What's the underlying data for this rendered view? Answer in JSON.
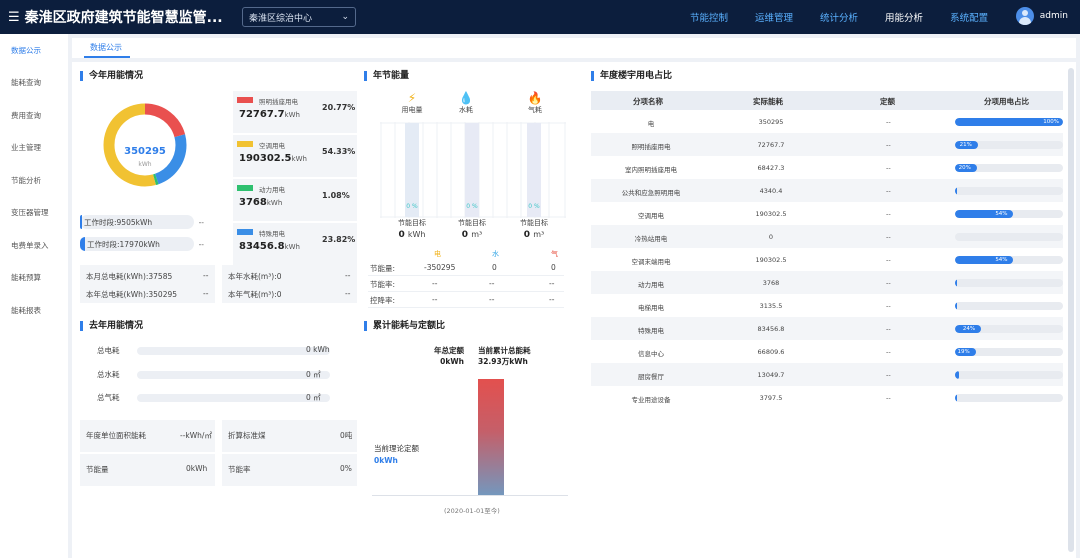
{
  "header": {
    "title": "秦淮区政府建筑节能智慧监管...",
    "org_select": "秦淮区综治中心",
    "nav": [
      "节能控制",
      "运维管理",
      "统计分析",
      "用能分析",
      "系统配置"
    ],
    "nav_active": 3,
    "user": "admin"
  },
  "sidebar": {
    "items": [
      "数据公示",
      "能耗查询",
      "费用查询",
      "业主管理",
      "节能分析",
      "变压器管理",
      "电费单录入",
      "能耗预算",
      "能耗报表"
    ]
  },
  "tab": {
    "label": "数据公示"
  },
  "this_year": {
    "title": "今年用能情况",
    "total": "350295",
    "total_unit": "kWh",
    "work_periods": [
      {
        "label": "工作时段:9505kWh",
        "dash": "--"
      },
      {
        "label": "工作时段:17970kWh",
        "dash": "--"
      }
    ],
    "categories": [
      {
        "name": "照明插座用电",
        "value": "72767.7",
        "unit": "kWh",
        "pct": "20.77%",
        "color": "#e9504f",
        "share": 20.77
      },
      {
        "name": "空调用电",
        "value": "190302.5",
        "unit": "kWh",
        "pct": "54.33%",
        "color": "#f1c232",
        "share": 54.33
      },
      {
        "name": "动力用电",
        "value": "3768",
        "unit": "kWh",
        "pct": "1.08%",
        "color": "#2ec06f",
        "share": 1.08
      },
      {
        "name": "特殊用电",
        "value": "83456.8",
        "unit": "kWh",
        "pct": "23.82%",
        "color": "#3a8ee6",
        "share": 23.82
      }
    ],
    "summary": {
      "month_elec": "本月总电耗(kWh):37585",
      "year_elec": "本年总电耗(kWh):350295",
      "year_water": "本年水耗(m³):0",
      "year_gas": "本年气耗(m³):0",
      "dash": "--"
    }
  },
  "saving": {
    "title": "年节能量",
    "columns": [
      {
        "label": "用电量",
        "icon": "lightning-icon",
        "glyph": "⚡",
        "color": "#f1b21b",
        "pct": "0 %",
        "target_label": "节能目标",
        "target": "0",
        "target_unit": "kWh"
      },
      {
        "label": "水耗",
        "icon": "water-drop-icon",
        "glyph": "💧",
        "color": "#37a7e6",
        "pct": "0 %",
        "target_label": "节能目标",
        "target": "0",
        "target_unit": "m³"
      },
      {
        "label": "气耗",
        "icon": "flame-icon",
        "glyph": "🔥",
        "color": "#e64c3c",
        "pct": "0 %",
        "target_label": "节能目标",
        "target": "0",
        "target_unit": "m³"
      }
    ],
    "table_headers": [
      "电",
      "水",
      "气"
    ],
    "rows": [
      {
        "label": "节能量:",
        "values": [
          "-350295",
          "0",
          "0"
        ]
      },
      {
        "label": "节能率:",
        "values": [
          "--",
          "--",
          "--"
        ]
      },
      {
        "label": "控降率:",
        "values": [
          "--",
          "--",
          "--"
        ]
      }
    ]
  },
  "last_year": {
    "title": "去年用能情况",
    "bars": [
      {
        "label": "总电耗",
        "value": "0 kWh"
      },
      {
        "label": "总水耗",
        "value": "0 ㎡"
      },
      {
        "label": "总气耗",
        "value": "0 ㎡"
      }
    ],
    "boxes": [
      {
        "label": "年度单位面积能耗",
        "value": "--kWh/㎡"
      },
      {
        "label": "折算标准煤",
        "value": "0吨"
      },
      {
        "label": "节能量",
        "value": "0kWh"
      },
      {
        "label": "节能率",
        "value": "0%"
      }
    ]
  },
  "cumulative": {
    "title": "累计能耗与定额比",
    "annual_quota_label": "年总定额",
    "annual_quota_value": "0kWh",
    "current_total_label": "当前累计总能耗",
    "current_total_value": "32.93万kWh",
    "theory_label": "当前理论定额",
    "theory_value": "0kWh",
    "date": "(2020-01-01至今)"
  },
  "building": {
    "title": "年度楼宇用电占比",
    "headers": [
      "分项名称",
      "实际能耗",
      "定额",
      "分项用电占比"
    ],
    "rows": [
      {
        "name": "电",
        "actual": "350295",
        "quota": "--",
        "pct": 100,
        "pct_label": "100%"
      },
      {
        "name": "照明插座用电",
        "actual": "72767.7",
        "quota": "--",
        "pct": 21,
        "pct_label": "21%"
      },
      {
        "name": "室内照明插座用电",
        "actual": "68427.3",
        "quota": "--",
        "pct": 20,
        "pct_label": "20%"
      },
      {
        "name": "公共和应急照明用电",
        "actual": "4340.4",
        "quota": "--",
        "pct": 1,
        "pct_label": ""
      },
      {
        "name": "空调用电",
        "actual": "190302.5",
        "quota": "--",
        "pct": 54,
        "pct_label": "54%"
      },
      {
        "name": "冷热站用电",
        "actual": "0",
        "quota": "--",
        "pct": 0,
        "pct_label": ""
      },
      {
        "name": "空调末端用电",
        "actual": "190302.5",
        "quota": "--",
        "pct": 54,
        "pct_label": "54%"
      },
      {
        "name": "动力用电",
        "actual": "3768",
        "quota": "--",
        "pct": 1,
        "pct_label": ""
      },
      {
        "name": "电梯用电",
        "actual": "3135.5",
        "quota": "--",
        "pct": 1,
        "pct_label": ""
      },
      {
        "name": "特殊用电",
        "actual": "83456.8",
        "quota": "--",
        "pct": 24,
        "pct_label": "24%"
      },
      {
        "name": "信息中心",
        "actual": "66809.6",
        "quota": "--",
        "pct": 19,
        "pct_label": "19%"
      },
      {
        "name": "厨房餐厅",
        "actual": "13049.7",
        "quota": "--",
        "pct": 4,
        "pct_label": ""
      },
      {
        "name": "专业用途设备",
        "actual": "3797.5",
        "quota": "--",
        "pct": 1,
        "pct_label": ""
      }
    ]
  }
}
